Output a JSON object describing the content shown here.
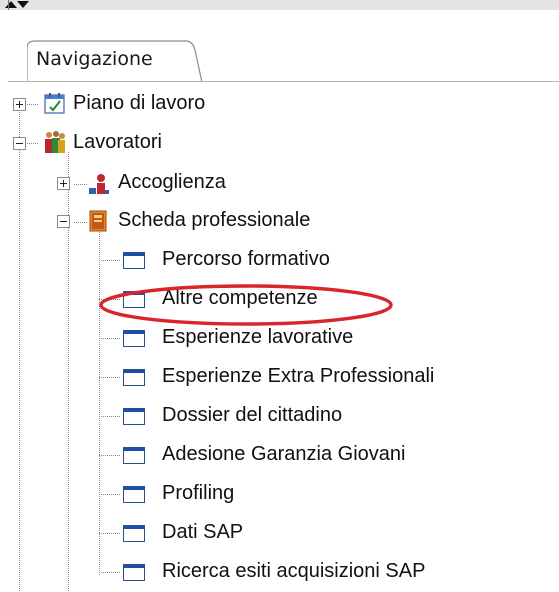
{
  "tabs": [
    {
      "label": "Navigazione",
      "active": true
    }
  ],
  "tree": [
    {
      "label": "Piano di lavoro",
      "icon": "calendar-icon",
      "expander": "plus",
      "level": 0
    },
    {
      "label": "Lavoratori",
      "icon": "people-icon",
      "expander": "minus",
      "level": 0
    },
    {
      "label": "Accoglienza",
      "icon": "reception-icon",
      "expander": "plus",
      "level": 1
    },
    {
      "label": "Scheda professionale",
      "icon": "folder-book-icon",
      "expander": "minus",
      "level": 1
    },
    {
      "label": "Percorso formativo",
      "icon": "window-icon",
      "level": 2
    },
    {
      "label": "Altre competenze",
      "icon": "window-icon",
      "level": 2,
      "highlighted": true
    },
    {
      "label": "Esperienze lavorative",
      "icon": "window-icon",
      "level": 2
    },
    {
      "label": "Esperienze Extra Professionali",
      "icon": "window-icon",
      "level": 2
    },
    {
      "label": "Dossier del cittadino",
      "icon": "window-icon",
      "level": 2
    },
    {
      "label": "Adesione Garanzia Giovani",
      "icon": "window-icon",
      "level": 2
    },
    {
      "label": "Profiling",
      "icon": "window-icon",
      "level": 2
    },
    {
      "label": "Dati SAP",
      "icon": "window-icon",
      "level": 2
    },
    {
      "label": "Ricerca esiti acquisizioni SAP",
      "icon": "window-icon",
      "level": 2
    }
  ],
  "colors": {
    "highlight_ellipse": "#d9262b",
    "window_icon_title": "#1f4ea8"
  }
}
